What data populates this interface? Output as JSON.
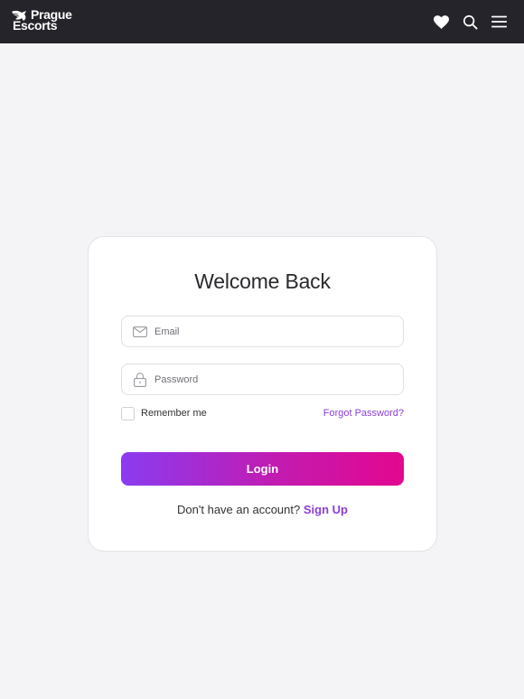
{
  "header": {
    "logo_line1": "Prague",
    "logo_line2": "Escorts",
    "icons": [
      "heart-icon",
      "search-icon",
      "hamburger-menu-icon"
    ]
  },
  "login": {
    "title": "Welcome Back",
    "email_placeholder": "Email",
    "password_placeholder": "Password",
    "remember_label": "Remember me",
    "forgot_label": "Forgot Password?",
    "login_label": "Login",
    "signup_prompt": "Don't have an account?",
    "signup_label": "Sign Up"
  },
  "colors": {
    "header_bg": "#24242a",
    "page_bg": "#f4f4f6",
    "accent": "#8b3fd6",
    "gradient_start": "#8a3cf0",
    "gradient_end": "#e3078f"
  }
}
